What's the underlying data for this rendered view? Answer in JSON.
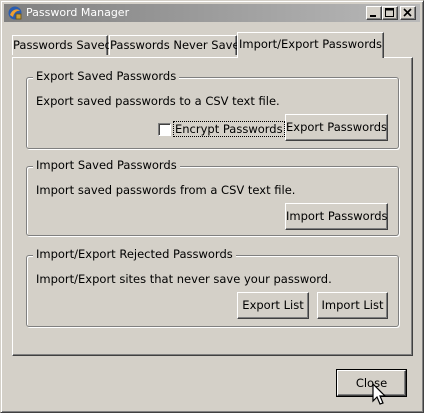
{
  "window": {
    "title": "Password Manager",
    "app_icon": "password-manager-icon",
    "controls": {
      "minimize": "minimize-icon",
      "maximize": "maximize-icon",
      "close": "close-x-icon"
    }
  },
  "tabs": [
    {
      "label": "Passwords Saved",
      "active": false
    },
    {
      "label": "Passwords Never Saved",
      "active": false
    },
    {
      "label": "Import/Export Passwords",
      "active": true
    }
  ],
  "export_group": {
    "title": "Export Saved Passwords",
    "description": "Export saved passwords to a CSV text file.",
    "encrypt_label": "Encrypt Passwords",
    "encrypt_checked": false,
    "button": "Export Passwords"
  },
  "import_group": {
    "title": "Import Saved Passwords",
    "description": "Import saved passwords from a CSV text file.",
    "button": "Import Passwords"
  },
  "rejected_group": {
    "title": "Import/Export Rejected Passwords",
    "description": "Import/Export sites that never save your password.",
    "export_button": "Export List",
    "import_button": "Import List"
  },
  "footer": {
    "close_button": "Close"
  },
  "colors": {
    "face": "#d4d0c8",
    "titlebar_start": "#808080",
    "titlebar_end": "#b9b9b9"
  }
}
